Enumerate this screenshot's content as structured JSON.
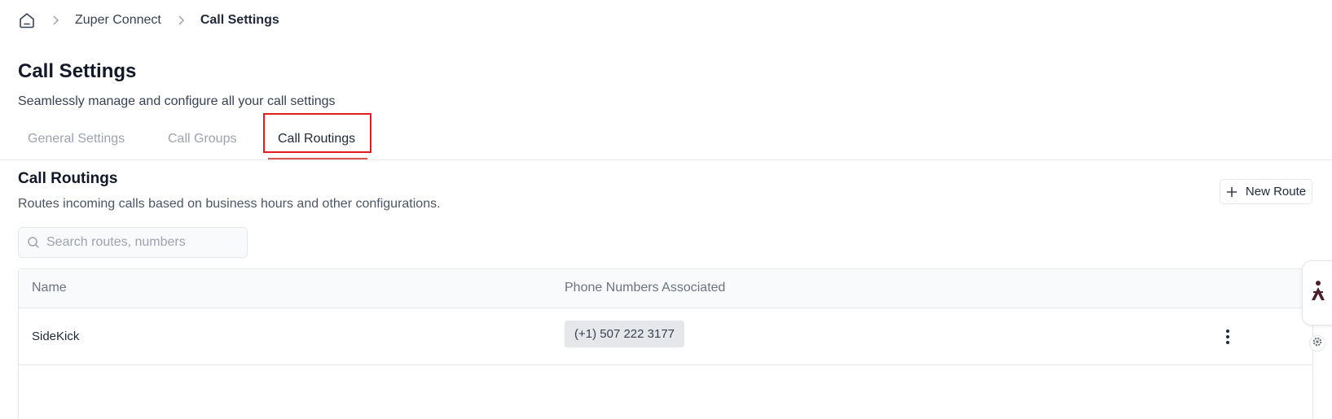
{
  "breadcrumb": {
    "home_icon": "home-icon",
    "items": [
      "Zuper Connect",
      "Call Settings"
    ]
  },
  "header": {
    "title": "Call Settings",
    "subtitle": "Seamlessly manage and configure all your call settings"
  },
  "tabs": [
    {
      "label": "General Settings",
      "active": false
    },
    {
      "label": "Call Groups",
      "active": false
    },
    {
      "label": "Call Routings",
      "active": true
    }
  ],
  "section": {
    "title": "Call Routings",
    "subtitle": "Routes incoming calls based on business hours and other configurations.",
    "new_button_label": "New Route"
  },
  "search": {
    "placeholder": "Search routes, numbers",
    "value": ""
  },
  "table": {
    "columns": [
      "Name",
      "Phone Numbers Associated"
    ],
    "rows": [
      {
        "name": "SideKick",
        "phone": "(+1) 507 222 3177"
      }
    ]
  },
  "colors": {
    "accent_underline": "#d9534f",
    "highlight_box": "#e11d1d",
    "widget_icon": "#4a1f2a"
  }
}
